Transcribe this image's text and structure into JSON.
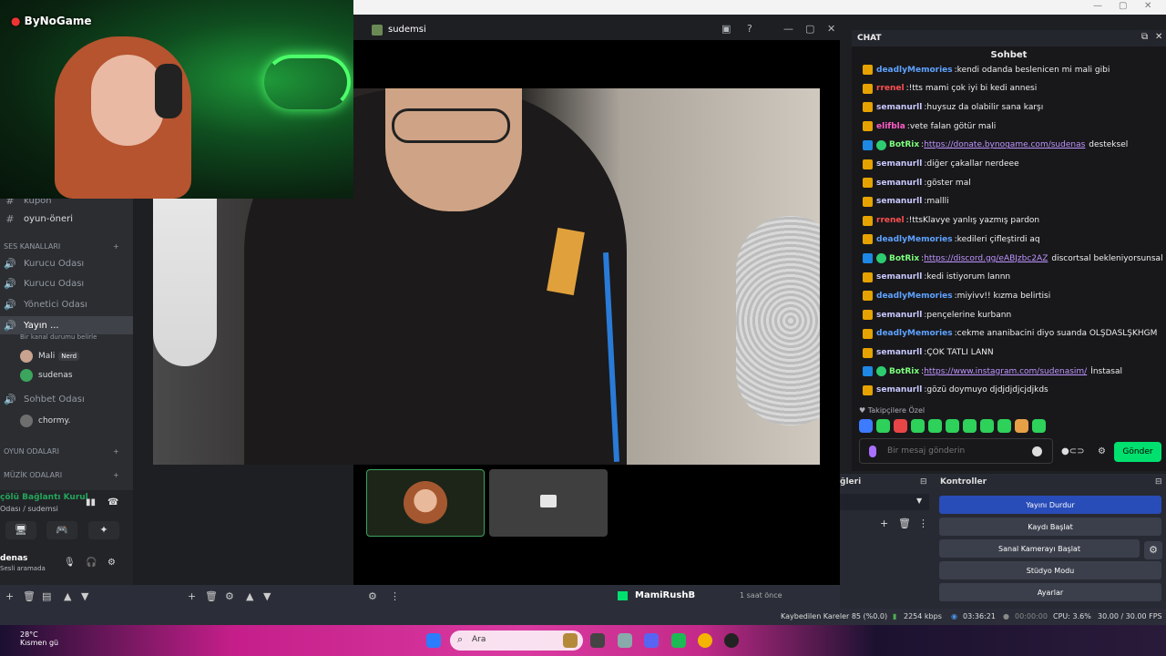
{
  "webcam": {
    "logo": "ByNoGame"
  },
  "discord": {
    "channels": [
      {
        "label": "kupon",
        "y": 0
      },
      {
        "label": "oyun-öneri"
      }
    ],
    "category_voice": "SES KANALLARI",
    "voice_channels": [
      {
        "label": "Kurucu Odası"
      },
      {
        "label": "Kurucu Odası"
      },
      {
        "label": "Yönetici Odası"
      },
      {
        "label": "Yayın ..."
      }
    ],
    "status_placeholder": "Bir kanal durumu belirle",
    "members": [
      {
        "name": "Mali",
        "tag": "Nerd"
      },
      {
        "name": "sudenas"
      }
    ],
    "sohbet_channel": "Sohbet Odası",
    "sohbet_member": "chormy.",
    "category_games": "OYUN ODALARI",
    "category_music": "MÜZİK ODALARI",
    "vc_title": "çölü Bağlantı Kurul",
    "vc_sub": "Odası / sudemsi",
    "user_name": "denas",
    "user_status": "Sesli aramada"
  },
  "video": {
    "title": "sudemsi"
  },
  "chat": {
    "header": "CHAT",
    "title": "Sohbet",
    "messages": [
      {
        "name": "deadlyMemories",
        "color": "#5ea2ff",
        "text": "kendi odanda beslenicen mi mali gibi"
      },
      {
        "name": "rrenel",
        "color": "#ff4f4f",
        "text": "!tts mami çok iyi bi kedi annesi"
      },
      {
        "name": "semanurll",
        "color": "#c8c8ff",
        "text": "huysuz da olabilir sana karşı"
      },
      {
        "name": "elifbla",
        "color": "#ff5ec8",
        "text": "vete falan götür mali"
      },
      {
        "name": "BotRix",
        "color": "#7cff7c",
        "link": "https://donate.bynogame.com/sudenas",
        "text": "desteksel"
      },
      {
        "name": "semanurll",
        "color": "#c8c8ff",
        "text": "diğer çakallar nerdeee"
      },
      {
        "name": "semanurll",
        "color": "#c8c8ff",
        "text": "göster mal"
      },
      {
        "name": "semanurll",
        "color": "#c8c8ff",
        "text": "mallli"
      },
      {
        "name": "rrenel",
        "color": "#ff4f4f",
        "text": "!ttsKlavye yanlış yazmış pardon"
      },
      {
        "name": "deadlyMemories",
        "color": "#5ea2ff",
        "text": "kedileri çifleştirdi aq"
      },
      {
        "name": "BotRix",
        "color": "#7cff7c",
        "link": "https://discord.gg/eABJzbc2AZ",
        "text": "discortsal bekleniyorsunsal"
      },
      {
        "name": "semanurll",
        "color": "#c8c8ff",
        "text": "kedi istiyorum lannn"
      },
      {
        "name": "deadlyMemories",
        "color": "#5ea2ff",
        "text": "miyivv!! kızma belirtisi"
      },
      {
        "name": "semanurll",
        "color": "#c8c8ff",
        "text": "pençelerine kurbann"
      },
      {
        "name": "deadlyMemories",
        "color": "#5ea2ff",
        "text": "cekme ananibacini diyo suanda ÖLŞDASLŞKHGM"
      },
      {
        "name": "semanurll",
        "color": "#c8c8ff",
        "text": "ÇOK TATLI LANN"
      },
      {
        "name": "BotRix",
        "color": "#7cff7c",
        "link": "https://www.instagram.com/sudenasim/",
        "text": "İnstasal"
      },
      {
        "name": "semanurll",
        "color": "#c8c8ff",
        "text": "gözü doymuyo djdjdjdjcjdjkds"
      }
    ],
    "followers_only": "Takipçilere Özel",
    "input_placeholder": "Bir mesaj gönderin",
    "send_label": "Gönder"
  },
  "obs": {
    "sources_header": "ğleri",
    "controls_header": "Kontroller",
    "buttons": [
      "Yayını Durdur",
      "Kaydı Başlat",
      "Sanal Kamerayı Başlat",
      "Stüdyo Modu",
      "Ayarlar"
    ],
    "scene_name": "MamiRushB",
    "scene_time": "1 saat önce"
  },
  "statusbar": {
    "dropped": "Kaybedilen Kareler 85 (%0.0)",
    "bitrate": "2254 kbps",
    "live_time": "03:36:21",
    "rec_time": "00:00:00",
    "cpu": "CPU: 3.6%",
    "fps": "30.00 / 30.00 FPS"
  },
  "taskbar": {
    "temp": "28°C",
    "weather": "Kısmen gü",
    "search": "Ara"
  }
}
